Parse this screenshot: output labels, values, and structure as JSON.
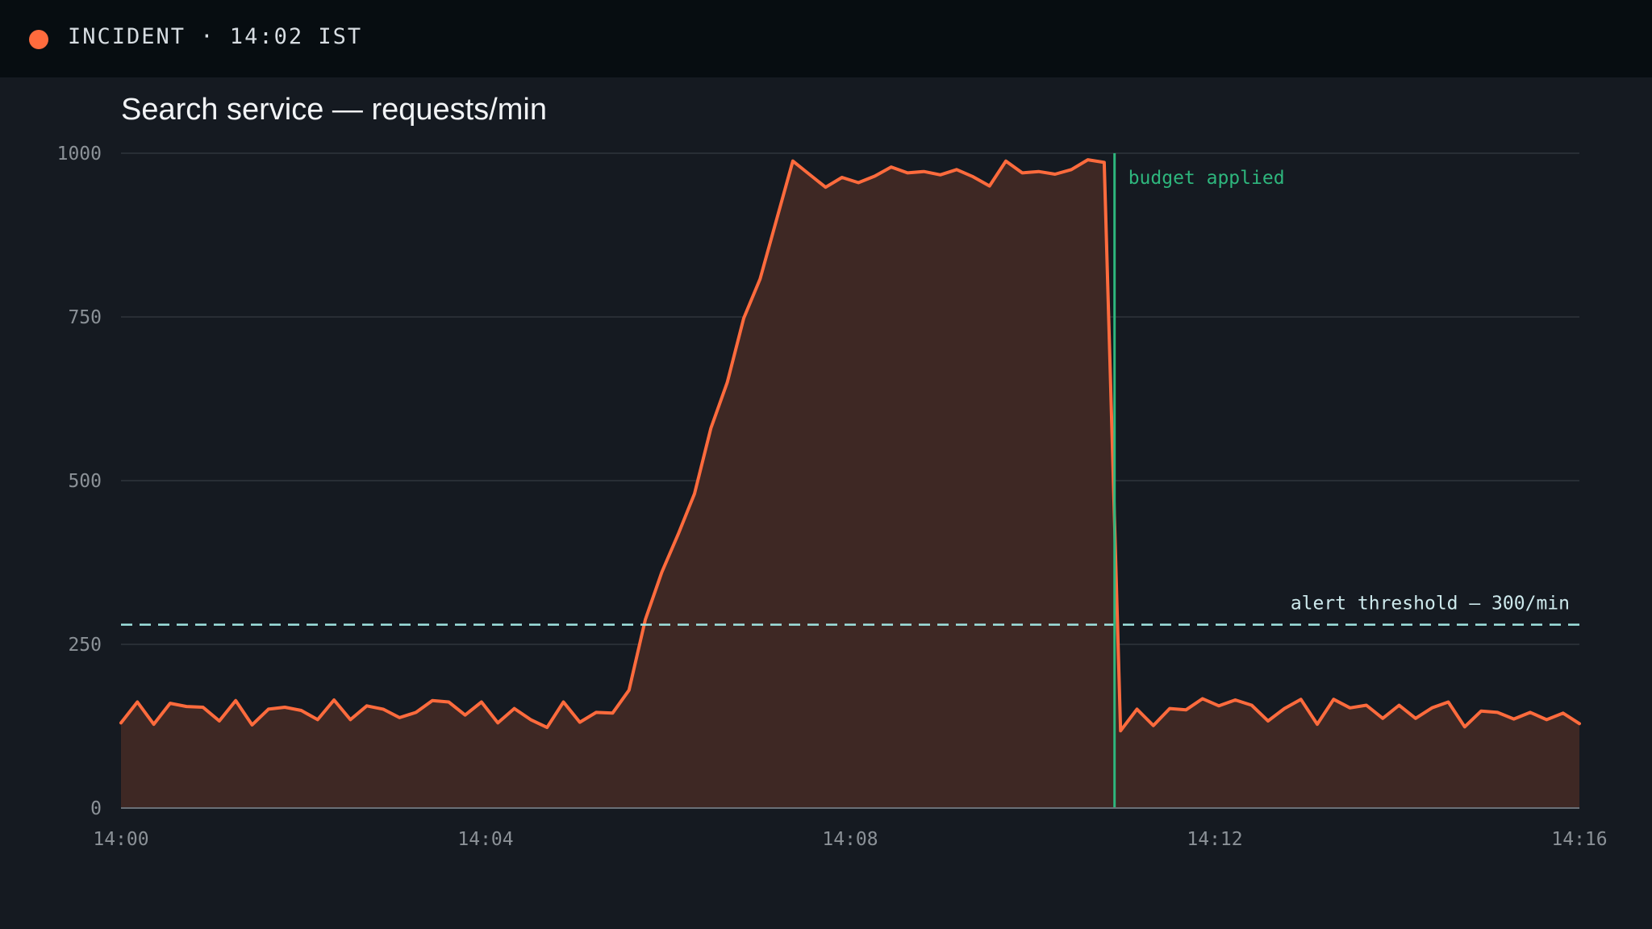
{
  "status": {
    "label": "INCIDENT · 14:02 IST",
    "dot_color": "#ff6b3d"
  },
  "chart_data": {
    "type": "area",
    "title": "Search service — requests/min",
    "xlabel": "",
    "ylabel": "",
    "xlim": [
      "14:00",
      "14:16"
    ],
    "ylim": [
      0,
      1000
    ],
    "x_ticks": [
      "14:00",
      "14:04",
      "14:08",
      "14:12",
      "14:16"
    ],
    "y_ticks": [
      0,
      250,
      500,
      750,
      1000
    ],
    "grid": true,
    "colors": {
      "series": "#ff6b3d",
      "fill": "#3e2824",
      "threshold": "#9fe3e0",
      "annotation": "#2eb67d",
      "grid": "#2f353c",
      "baseline": "#6a7077"
    },
    "series": [
      {
        "x_minutes_from_14_00": "every 10 seconds, 0 to 16",
        "values": [
          130,
          162,
          128,
          160,
          155,
          154,
          133,
          164,
          127,
          151,
          154,
          149,
          135,
          165,
          135,
          156,
          151,
          138,
          146,
          164,
          162,
          142,
          162,
          130,
          152,
          135,
          123,
          162,
          131,
          146,
          145,
          180,
          288,
          360,
          418,
          480,
          580,
          650,
          748,
          808,
          898,
          988,
          968,
          948,
          963,
          955,
          965,
          979,
          970,
          972,
          967,
          975,
          964,
          950,
          988,
          970,
          972,
          968,
          975,
          990,
          986,
          118,
          151,
          126,
          152,
          150,
          167,
          156,
          165,
          157,
          133,
          152,
          166,
          128,
          166,
          153,
          157,
          137,
          157,
          137,
          153,
          162,
          124,
          148,
          146,
          136,
          146,
          135,
          145,
          129
        ]
      }
    ],
    "threshold": {
      "value": 280,
      "label": "alert threshold — 300/min"
    },
    "event": {
      "x": "14:10:54",
      "label": "budget applied"
    }
  }
}
